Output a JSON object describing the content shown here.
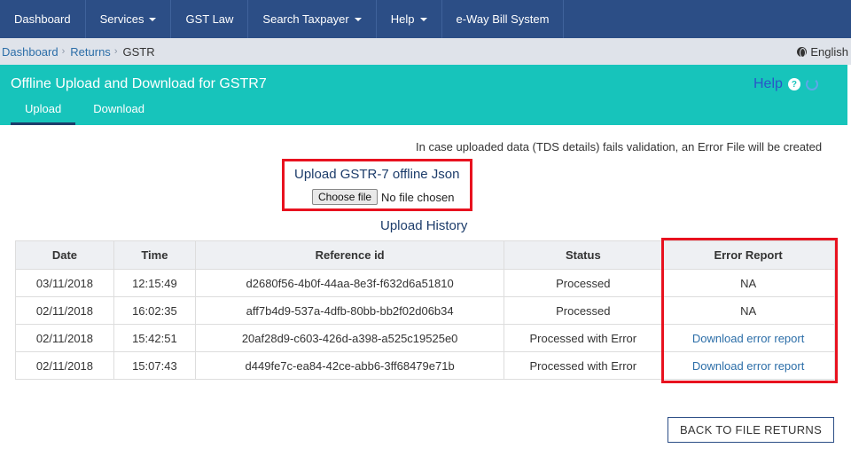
{
  "nav": {
    "items": [
      {
        "label": "Dashboard",
        "dropdown": false
      },
      {
        "label": "Services",
        "dropdown": true
      },
      {
        "label": "GST Law",
        "dropdown": false
      },
      {
        "label": "Search Taxpayer",
        "dropdown": true
      },
      {
        "label": "Help",
        "dropdown": true
      },
      {
        "label": "e-Way Bill System",
        "dropdown": false
      }
    ]
  },
  "breadcrumb": {
    "items": [
      "Dashboard",
      "Returns"
    ],
    "current": "GSTR",
    "language": "English"
  },
  "header": {
    "title": "Offline Upload and Download for GSTR7",
    "help_label": "Help",
    "help_icon": "?",
    "tabs": [
      "Upload",
      "Download"
    ],
    "active_tab": "Upload"
  },
  "info_text": "In case uploaded data (TDS details) fails validation, an Error File will be created",
  "upload": {
    "title": "Upload GSTR-7 offline Json",
    "choose_label": "Choose file",
    "no_file_label": "No file chosen"
  },
  "history": {
    "title": "Upload History",
    "columns": [
      "Date",
      "Time",
      "Reference id",
      "Status",
      "Error Report"
    ],
    "rows": [
      {
        "date": "03/11/2018",
        "time": "12:15:49",
        "ref": "d2680f56-4b0f-44aa-8e3f-f632d6a51810",
        "status": "Processed",
        "error": "NA",
        "error_link": false
      },
      {
        "date": "02/11/2018",
        "time": "16:02:35",
        "ref": "aff7b4d9-537a-4dfb-80bb-bb2f02d06b34",
        "status": "Processed",
        "error": "NA",
        "error_link": false
      },
      {
        "date": "02/11/2018",
        "time": "15:42:51",
        "ref": "20af28d9-c603-426d-a398-a525c19525e0",
        "status": "Processed with Error",
        "error": "Download error report",
        "error_link": true
      },
      {
        "date": "02/11/2018",
        "time": "15:07:43",
        "ref": "d449fe7c-ea84-42ce-abb6-3ff68479e71b",
        "status": "Processed with Error",
        "error": "Download error report",
        "error_link": true
      }
    ]
  },
  "back_button": "BACK TO FILE RETURNS",
  "colors": {
    "nav_bg": "#2c4e86",
    "header_teal": "#17c4bb",
    "highlight_red": "#e8121f",
    "link_blue": "#2c6ea8"
  }
}
